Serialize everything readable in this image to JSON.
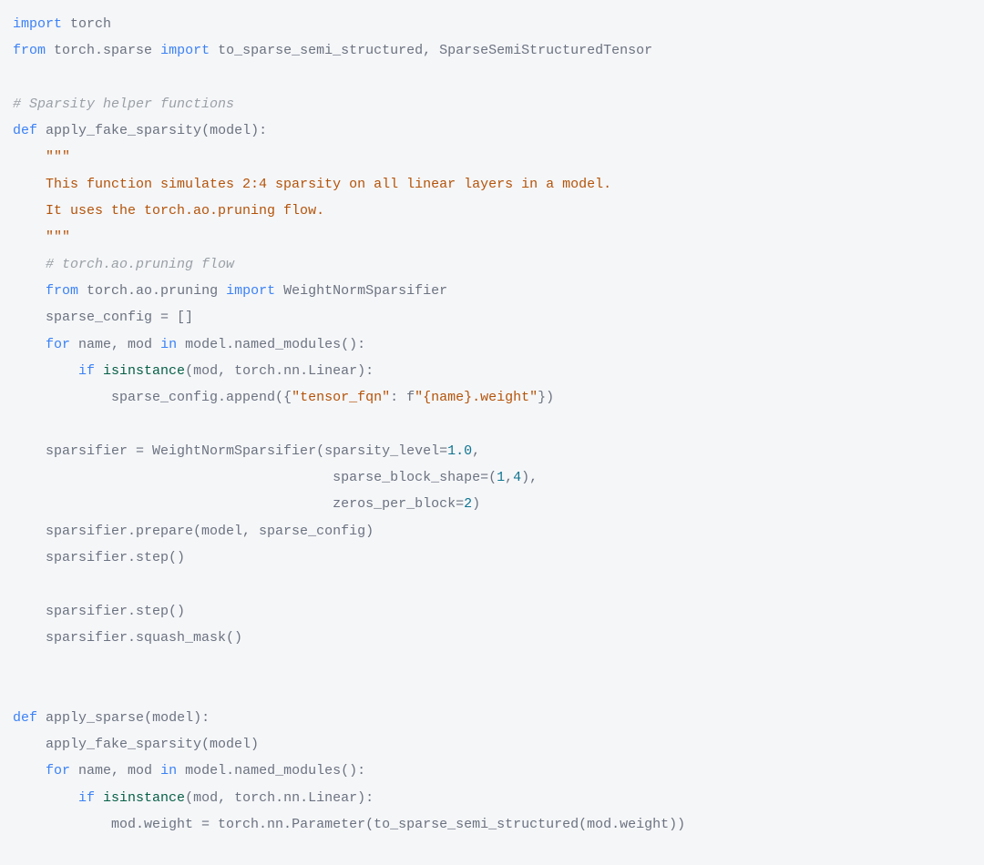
{
  "code": {
    "l01": {
      "kw_import": "import",
      "sp": " ",
      "m_torch": "torch"
    },
    "l02": {
      "kw_from": "from",
      "sp": " ",
      "m1": "torch.sparse",
      "kw_import": " import ",
      "n1": "to_sparse_semi_structured, SparseSemiStructuredTensor"
    },
    "l03": "",
    "l04": {
      "cmt": "# Sparsity helper functions"
    },
    "l05": {
      "kw_def": "def",
      "sp": " ",
      "fn": "apply_fake_sparsity",
      "paren": "(model):"
    },
    "l06": {
      "ind": "    ",
      "doc": "\"\"\""
    },
    "l07": {
      "ind": "    ",
      "doc": "This function simulates 2:4 sparsity on all linear layers in a model."
    },
    "l08": {
      "ind": "    ",
      "doc": "It uses the torch.ao.pruning flow."
    },
    "l09": {
      "ind": "    ",
      "doc": "\"\"\""
    },
    "l10": {
      "ind": "    ",
      "cmt": "# torch.ao.pruning flow"
    },
    "l11": {
      "ind": "    ",
      "kw_from": "from",
      "sp": " ",
      "m1": "torch.ao.pruning",
      "kw_import": " import ",
      "n1": "WeightNormSparsifier"
    },
    "l12": {
      "ind": "    ",
      "txt": "sparse_config = []"
    },
    "l13": {
      "ind": "    ",
      "kw_for": "for",
      "mid": " name, mod ",
      "kw_in": "in",
      "rest": " model.named_modules():"
    },
    "l14": {
      "ind": "        ",
      "kw_if": "if",
      "sp": " ",
      "fn": "isinstance",
      "rest": "(mod, torch.nn.Linear):"
    },
    "l15": {
      "ind": "            ",
      "pre": "sparse_config.append({",
      "s1": "\"tensor_fqn\"",
      "mid": ": f",
      "s2": "\"{name}.weight\"",
      "post": "})"
    },
    "l16": "",
    "l17": {
      "ind": "    ",
      "pre": "sparsifier = WeightNormSparsifier(sparsity_level=",
      "num": "1.0",
      "post": ","
    },
    "l18": {
      "ind": "                                       ",
      "pre": "sparse_block_shape=(",
      "n1": "1",
      "c": ",",
      "n2": "4",
      "post": "),"
    },
    "l19": {
      "ind": "                                       ",
      "pre": "zeros_per_block=",
      "num": "2",
      "post": ")"
    },
    "l20": {
      "ind": "    ",
      "txt": "sparsifier.prepare(model, sparse_config)"
    },
    "l21": {
      "ind": "    ",
      "txt": "sparsifier.step()"
    },
    "l22": "",
    "l23": {
      "ind": "    ",
      "txt": "sparsifier.step()"
    },
    "l24": {
      "ind": "    ",
      "txt": "sparsifier.squash_mask()"
    },
    "l25": "",
    "l26": "",
    "l27": {
      "kw_def": "def",
      "sp": " ",
      "fn": "apply_sparse",
      "paren": "(model):"
    },
    "l28": {
      "ind": "    ",
      "txt": "apply_fake_sparsity(model)"
    },
    "l29": {
      "ind": "    ",
      "kw_for": "for",
      "mid": " name, mod ",
      "kw_in": "in",
      "rest": " model.named_modules():"
    },
    "l30": {
      "ind": "        ",
      "kw_if": "if",
      "sp": " ",
      "fn": "isinstance",
      "rest": "(mod, torch.nn.Linear):"
    },
    "l31": {
      "ind": "            ",
      "txt": "mod.weight = torch.nn.Parameter(to_sparse_semi_structured(mod.weight))"
    }
  }
}
